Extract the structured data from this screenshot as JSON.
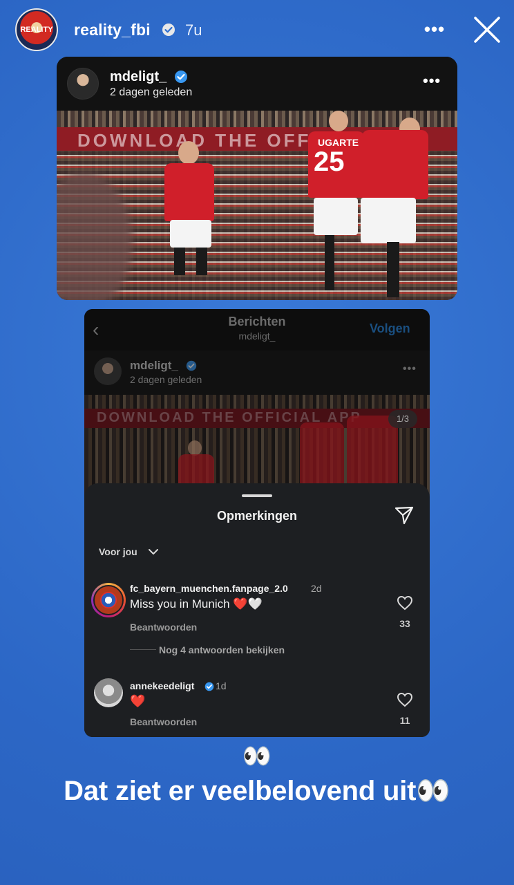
{
  "story": {
    "avatar_text": "REALITY",
    "username": "reality_fbi",
    "time": "7u",
    "more": "•••"
  },
  "post": {
    "username": "mdeligt_",
    "date": "2 dagen geleden",
    "more": "•••",
    "banner_text": "DOWNLOAD THE OFFICIAL APP",
    "player_numbers": [
      "25"
    ],
    "player_names": [
      "UGARTE"
    ]
  },
  "screenshot": {
    "header_title": "Berichten",
    "header_subtitle": "mdeligt_",
    "follow_label": "Volgen",
    "back_glyph": "‹",
    "post_username": "mdeligt_",
    "post_date": "2 dagen geleden",
    "more": "•••",
    "counter": "1/3",
    "banner_text": "DOWNLOAD THE OFFICIAL APP",
    "comments_title": "Opmerkingen",
    "filter_label": "Voor jou",
    "comments": [
      {
        "username": "fc_bayern_muenchen.fanpage_2.0",
        "age": "2d",
        "text": "Miss you in Munich ❤️🤍",
        "reply_label": "Beantwoorden",
        "likes": "33"
      },
      {
        "username": "annekeedeligt",
        "age": "1d",
        "text": "❤️",
        "reply_label": "Beantwoorden",
        "likes": "11"
      }
    ],
    "more_replies": "Nog 4 antwoorden bekijken"
  },
  "caption": {
    "eyes": "👀",
    "text": "Dat ziet er veelbelovend uit👀"
  },
  "colors": {
    "background": "#2f6fd0",
    "verified": "#3897f0",
    "united_red": "#d01f2a"
  }
}
